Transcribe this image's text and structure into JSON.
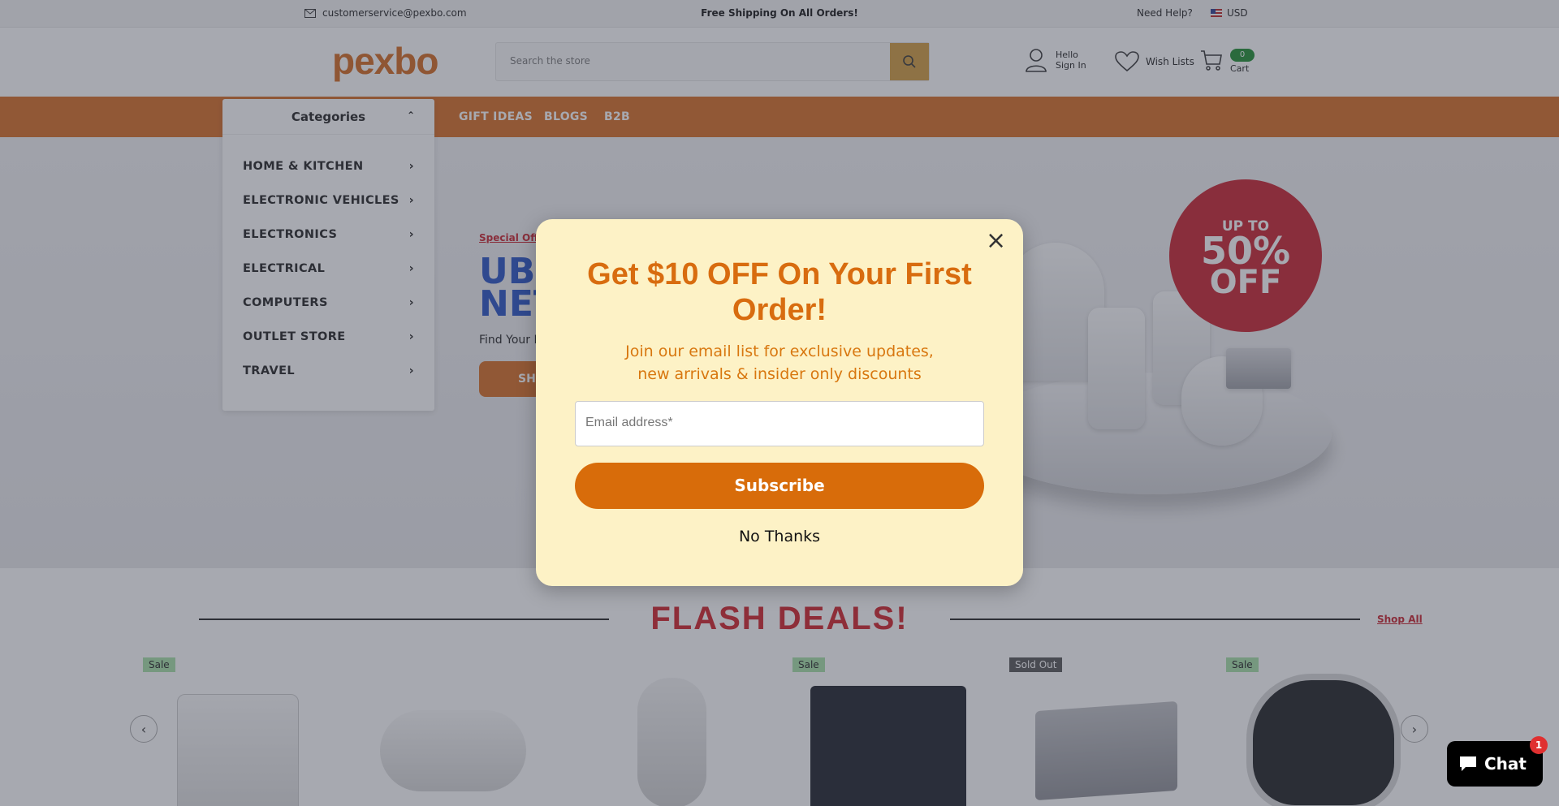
{
  "topbar": {
    "email": "customerservice@pexbo.com",
    "shipping": "Free Shipping On All Orders!",
    "help": "Need Help?",
    "currency": "USD"
  },
  "header": {
    "logo": "pexbo",
    "search_placeholder": "Search the store",
    "account_hello": "Hello",
    "account_signin": "Sign In",
    "wishlist": "Wish Lists",
    "cart_label": "Cart",
    "cart_count": "0"
  },
  "nav": {
    "categories": "Categories",
    "links": [
      "GIFT IDEAS",
      "BLOGS",
      "B2B"
    ]
  },
  "categories": [
    "HOME & KITCHEN",
    "ELECTRONIC VEHICLES",
    "ELECTRONICS",
    "ELECTRICAL",
    "COMPUTERS",
    "OUTLET STORE",
    "TRAVEL"
  ],
  "hero": {
    "special": "Special Off",
    "title1": "UBI",
    "title2": "NET",
    "subtitle": "Find Your F",
    "button": "SH",
    "badge_top": "UP TO",
    "badge_mid": "50%",
    "badge_bot": "OFF"
  },
  "flash": {
    "title": "FLASH DEALS!",
    "shop_all": "Shop All",
    "tags": [
      "Sale",
      "Sale",
      "Sold Out",
      "Sale"
    ]
  },
  "modal": {
    "title": "Get $10 OFF On Your First Order!",
    "subtitle": "Join our email list for exclusive updates, new arrivals & insider only discounts",
    "email_placeholder": "Email address*",
    "subscribe": "Subscribe",
    "no_thanks": "No Thanks"
  },
  "chat": {
    "label": "Chat",
    "badge": "1"
  },
  "colors": {
    "brand_orange": "#d86c22",
    "flash_red": "#d11f27",
    "modal_bg": "#fdf2c6"
  }
}
